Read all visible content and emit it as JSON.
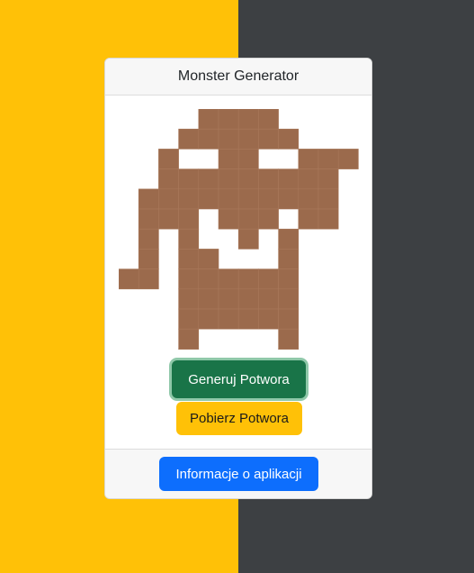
{
  "header": {
    "title": "Monster Generator"
  },
  "monster": {
    "color": "#9b6a4c",
    "grid": [
      "...........",
      "....XXXX...",
      "...XXXXXX..",
      "..X..XX..XXX",
      "..XXXXXXXXX",
      ".XXXXXXXXXX",
      ".XXX.XXX.XX",
      ".X.X..X.X..",
      ".X.XX...X..",
      "XX.XXXXXX..",
      "...XXXXXX..",
      "...XXXXXX..",
      "...X....X..",
      "...X....X.."
    ]
  },
  "actions": {
    "generate_label": "Generuj Potwora",
    "download_label": "Pobierz Potwora"
  },
  "footer": {
    "info_label": "Informacje o aplikacji"
  },
  "colors": {
    "left_background": "#ffc107",
    "right_background": "#3d4043",
    "generate_button": "#197448",
    "download_button": "#ffc107",
    "info_button": "#0d6efd"
  }
}
